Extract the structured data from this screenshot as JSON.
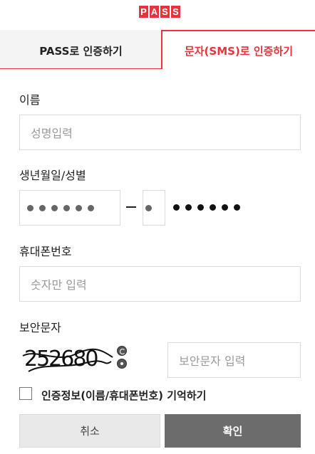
{
  "brand": {
    "logo_letters": [
      "P",
      "A",
      "S",
      "S"
    ],
    "color": "#e8323c"
  },
  "tabs": [
    {
      "label": "PASS로 인증하기",
      "active": false
    },
    {
      "label": "문자(SMS)로 인증하기",
      "active": true
    }
  ],
  "form": {
    "name": {
      "label": "이름",
      "placeholder": "성명입력"
    },
    "birth": {
      "label": "생년월일/성별",
      "birth_dots": 6,
      "gender_dots": 1,
      "masked_dots": 6
    },
    "phone": {
      "label": "휴대폰번호",
      "placeholder": "숫자만 입력"
    },
    "captcha": {
      "label": "보안문자",
      "image_text": "252680",
      "placeholder": "보안문자 입력",
      "refresh_icon": "refresh-icon",
      "audio_icon": "audio-icon"
    },
    "remember": {
      "label": "인증정보(이름/휴대폰번호) 기억하기",
      "checked": false
    }
  },
  "buttons": {
    "cancel": "취소",
    "confirm": "확인"
  }
}
